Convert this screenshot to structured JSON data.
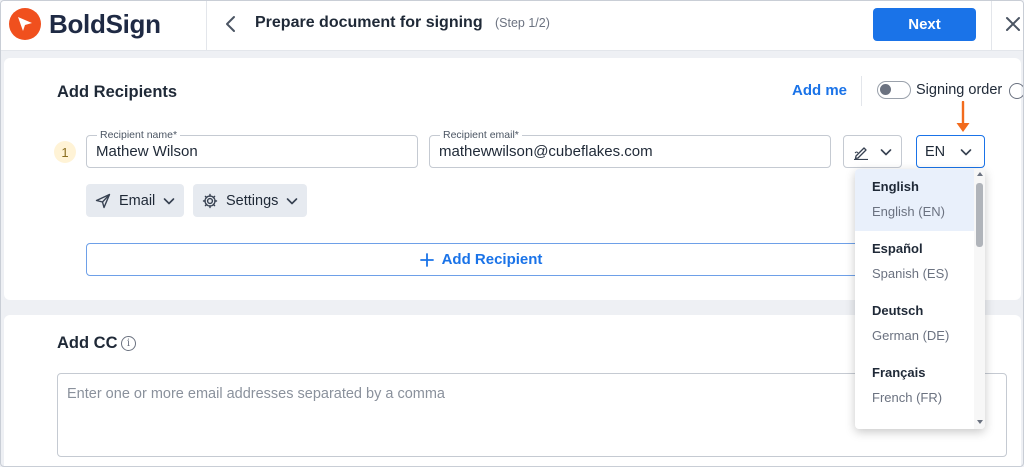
{
  "header": {
    "brand": "BoldSign",
    "title": "Prepare document for signing",
    "step": "(Step 1/2)",
    "next_label": "Next",
    "brand_color": "#f0501e",
    "accent_color": "#1a73e8"
  },
  "recipients": {
    "title": "Add Recipients",
    "add_me_label": "Add me",
    "signing_order_label": "Signing order",
    "signing_order_enabled": false,
    "add_recipient_label": "Add Recipient",
    "items": [
      {
        "number": "1",
        "name_label": "Recipient name*",
        "name_value": "Mathew Wilson",
        "email_label": "Recipient email*",
        "email_value": "mathewwilson@cubeflakes.com",
        "role_icon": "signer-pen-icon",
        "language_value": "EN",
        "delivery_label": "Email",
        "settings_label": "Settings"
      }
    ]
  },
  "cc": {
    "title": "Add CC",
    "placeholder": "Enter one or more email addresses separated by a comma"
  },
  "language_dropdown": {
    "selected_index": 0,
    "options": [
      {
        "name": "English",
        "sub": "English (EN)"
      },
      {
        "name": "Español",
        "sub": "Spanish (ES)"
      },
      {
        "name": "Deutsch",
        "sub": "German (DE)"
      },
      {
        "name": "Français",
        "sub": "French (FR)"
      }
    ]
  },
  "annotation": {
    "arrow_color": "#f26b1d"
  }
}
